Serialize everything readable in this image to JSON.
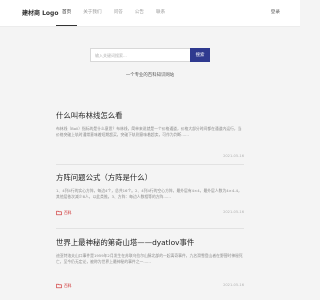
{
  "header": {
    "logo": "建材商 Logo",
    "nav": [
      "首页",
      "关于我们",
      "问答",
      "公告",
      "联系"
    ],
    "login": "登录"
  },
  "search": {
    "placeholder": "输入关键词搜索...",
    "button": "搜索"
  },
  "tagline": "一个专业的百科知识网站",
  "articles": [
    {
      "title": "什么叫布林线怎么看",
      "summary": "布林线（Boll）指标的是什么意思？布林线，简单来说就是一个价格通道，价格大部分时间都在通道内运行，当价格突破上轨时通常意味着短期超买，突破下轨则意味着超卖，可作为判断……",
      "date": "2021-05-16",
      "category": "百科"
    },
    {
      "title": "方阵问题公式（方阵是什么）",
      "summary": "1、4列4行的实心方阵，每边4个，总共16个。2、4列4行的空心方阵，最外层有4×4，最外层人数为4×4-4，其他层依次减少8人，以此类推。3、方阵：每边人数相等的方阵……",
      "date": "2021-05-16",
      "category": "百科"
    },
    {
      "title": "世界上最神秘的第奇山塔——dyatlov事件",
      "summary": "迪亚特洛夫山口事件是1959年2月发生在苏联乌拉尔山脉北部的一起离奇事件，九名滑雪登山者在野营时神秘死亡，至今仍无定论，被称为世界上最神秘的事件之一……",
      "date": "2021-05-16",
      "category": "百科"
    }
  ],
  "colors": {
    "accent": "#2f3a8f",
    "category": "#cc2222"
  }
}
